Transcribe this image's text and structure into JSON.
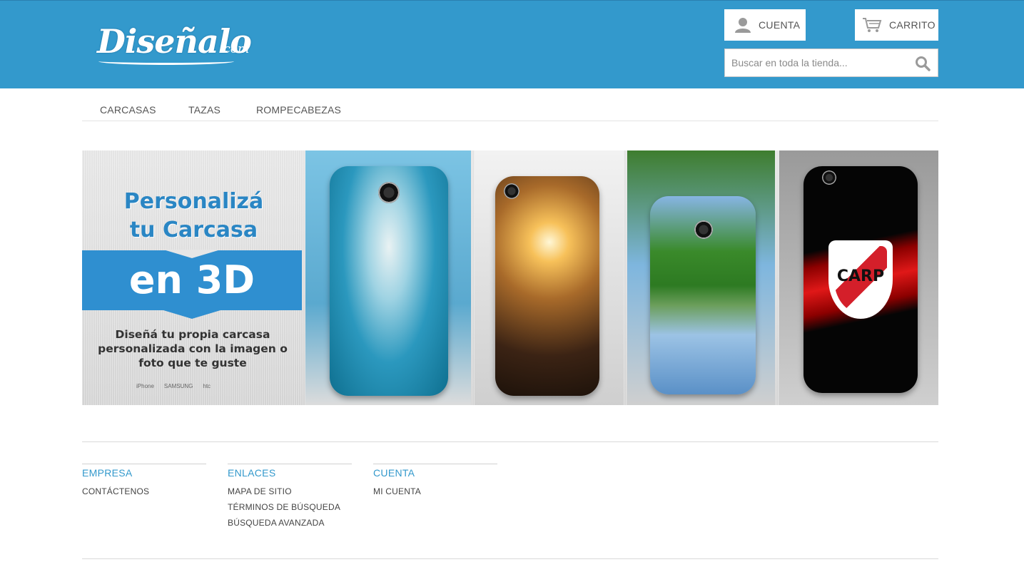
{
  "header": {
    "logo_text": "Diseñalo",
    "logo_suffix": ".com",
    "account_label": "CUENTA",
    "cart_label": "CARRITO",
    "search_placeholder": "Buscar en toda la tienda..."
  },
  "nav": {
    "items": [
      "CARCASAS",
      "TAZAS",
      "ROMPECABEZAS"
    ]
  },
  "banner": {
    "title_line1": "Personalizá",
    "title_line2": "tu Carcasa",
    "highlight": "en 3D",
    "subtitle": "Diseñá tu propia carcasa personalizada con la imagen o foto que te guste",
    "brands": [
      "iPhone",
      "SAMSUNG",
      "htc"
    ],
    "shield_text": "CARP"
  },
  "footer": {
    "columns": [
      {
        "title": "EMPRESA",
        "links": [
          "CONTÁCTENOS"
        ]
      },
      {
        "title": "ENLACES",
        "links": [
          "MAPA DE SITIO",
          "TÉRMINOS DE BÚSQUEDA",
          "BÚSQUEDA AVANZADA"
        ]
      },
      {
        "title": "CUENTA",
        "links": [
          "MI CUENTA"
        ]
      }
    ]
  },
  "colors": {
    "header_bg": "#3399cc",
    "accent": "#2f8fd0",
    "footer_heading": "#3399cc"
  }
}
